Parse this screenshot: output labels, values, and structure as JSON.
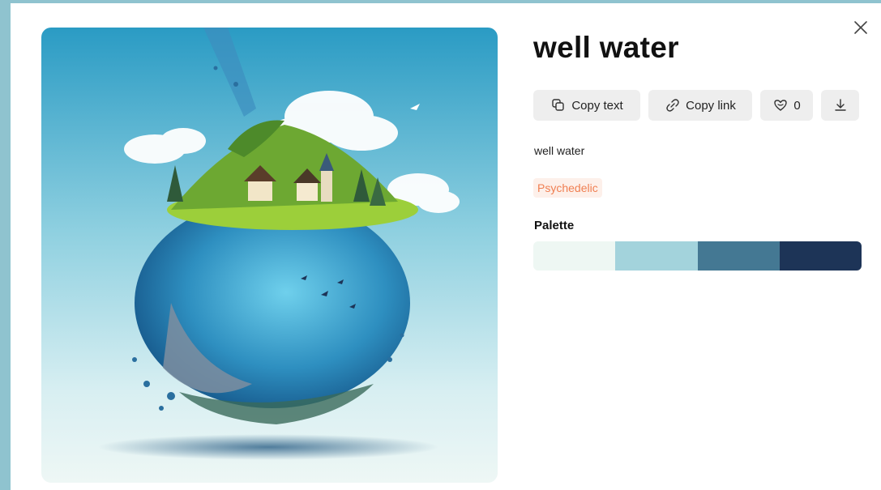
{
  "title": "well water",
  "prompt": "well water",
  "tag": "Psychedelic",
  "palette_label": "Palette",
  "actions": {
    "copy_text": "Copy text",
    "copy_link": "Copy link",
    "likes": "0"
  },
  "palette_colors": [
    "#eef7f3",
    "#a3d3dc",
    "#447893",
    "#1d3457"
  ],
  "icons": {
    "close": "close-icon",
    "copy": "copy-icon",
    "link": "link-icon",
    "heart": "heart-icon",
    "download": "download-icon"
  },
  "colors": {
    "tag_text": "#f07f52",
    "tag_bg": "#fdf0ea",
    "button_bg": "#eeeeee",
    "backdrop": "#8fc3cf"
  }
}
